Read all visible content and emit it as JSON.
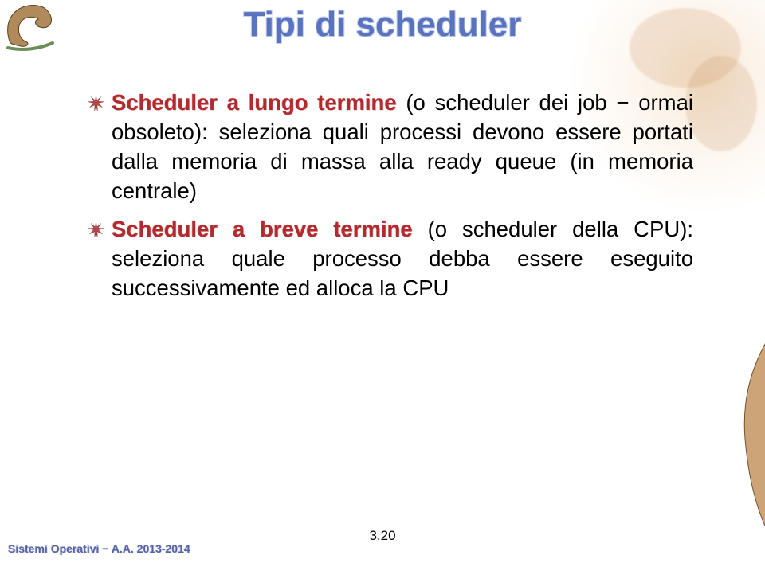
{
  "title": "Tipi di scheduler",
  "bullets": [
    {
      "label": "Scheduler a lungo termine",
      "rest_a": " (o scheduler dei job ",
      "dash": "−",
      "rest_b": " ormai obsoleto):  seleziona quali processi devono essere portati dalla memoria di massa alla ready queue (in memoria centrale)"
    },
    {
      "label": "Scheduler a breve termine",
      "rest_a": " (o scheduler della CPU): seleziona quale processo debba essere eseguito successivamente ed alloca la CPU",
      "dash": "",
      "rest_b": ""
    }
  ],
  "footer": {
    "left": "Sistemi Operativi − A.A. 2013-2014",
    "page": "3.20"
  },
  "icons": {
    "bullet": "star-burst-icon",
    "dino_top": "dinosaur-logo-icon",
    "dino_corner": "dinosaur-corner-icon"
  }
}
